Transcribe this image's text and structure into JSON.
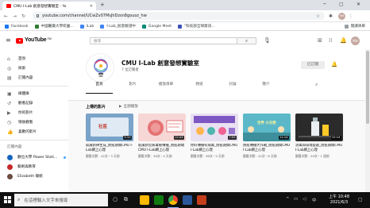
{
  "browser": {
    "tab_title": "CMU I-Lab 創意發想實驗室 - Yo",
    "new_tab": "+",
    "url": "youtube.com/channel/UCwZv07MsJhDzsn8gouoz_hw",
    "profile_initials": "MH"
  },
  "bookmarks": {
    "items": [
      {
        "label": "Facebook",
        "color": "#1877f2"
      },
      {
        "label": "中國醫藥大學校園...",
        "color": "#2e7d32"
      },
      {
        "label": "iLab",
        "color": "#4285f4"
      },
      {
        "label": "I-Lab_創意驗證中",
        "color": "#4285f4"
      },
      {
        "label": "Google Meet",
        "color": "#00897b"
      },
      {
        "label": "\"科技部全球資訊...",
        "color": "#3f51b5"
      }
    ],
    "reading_list": "閱讀清單"
  },
  "youtube": {
    "logo_text": "YouTube",
    "region": "TW",
    "search_placeholder": "搜尋",
    "avatar_initials": "MH"
  },
  "sidebar": {
    "items": [
      {
        "icon": "⌂",
        "label": "首頁"
      },
      {
        "icon": "◎",
        "label": "探索"
      },
      {
        "icon": "▤",
        "label": "訂閱內容"
      },
      {
        "icon": "▣",
        "label": "媒體庫"
      },
      {
        "icon": "↺",
        "label": "觀看記錄"
      },
      {
        "icon": "▶",
        "label": "你的影片"
      },
      {
        "icon": "◷",
        "label": "稍後觀看"
      },
      {
        "icon": "👍",
        "label": "喜歡的影片"
      }
    ],
    "subscriptions_heading": "訂閱內容",
    "subscriptions": [
      {
        "label": "數位大學 Power Stati...",
        "color": "#1565c0",
        "live": true
      },
      {
        "label": "藝術與教育",
        "color": "#c62828",
        "live": false
      },
      {
        "label": "Elizabeth 總統",
        "color": "#6d4c41",
        "live": false
      }
    ]
  },
  "channel": {
    "name": "CMU I-Lab 創意發想實驗室",
    "subscribers": "7 位訂閱者",
    "subscribe_label": "已訂閱",
    "tabs": [
      "首頁",
      "影片",
      "播放清單",
      "頻道",
      "討論",
      "簡介"
    ],
    "active_tab": 0
  },
  "shelf": {
    "title": "上傳的影片",
    "play_all": "全部播放",
    "videos": [
      {
        "title": "窮識新律生成_防疫期間CMU I-Lab網上心理",
        "meta": "觀看次數：42次・3 天前",
        "duration": "5:10",
        "thumb_text": "社區",
        "thumb_bg": "#7aa3c9"
      },
      {
        "title": "窮識新型病毒檢傳播_防疫期間CMU I-Lab網上心理",
        "meta": "觀看次數：36次・4 天前",
        "duration": "12:43",
        "thumb_text": "",
        "thumb_bg": "#f7d6d6"
      },
      {
        "title": "你好傳播有病毒_防疫期間CMU I-Lab網上心理",
        "meta": "觀看次數：38次・5 天前",
        "duration": "7:05",
        "thumb_text": "",
        "thumb_bg": "#e9e0f2"
      },
      {
        "title": "防疫傳播大作戰_防疫期間CMU I-Lab網上心理",
        "meta": "觀看次數：42次・6 天前",
        "duration": "11:14",
        "thumb_text": "世界 小天使",
        "thumb_bg": "#5bb8c8"
      },
      {
        "title": "消毒與環境殺菌_防疫期間CMU I-Lab網上心理",
        "meta": "觀看次數：29次・1 週前",
        "duration": "22:14",
        "thumb_text": "",
        "thumb_bg": "#2b2b2b"
      }
    ]
  },
  "taskbar": {
    "search_placeholder": "在這裡輸入文字來搜尋",
    "time": "上午 10:48",
    "date": "2021/6/3"
  }
}
